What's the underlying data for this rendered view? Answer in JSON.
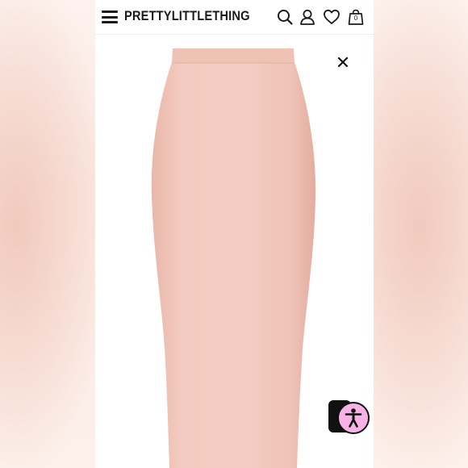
{
  "header": {
    "menu_icon": "hamburger-menu-icon",
    "brand": "PRETTYLITTLETHING",
    "icons": [
      "search-icon",
      "account-icon",
      "wishlist-heart-icon",
      "shopping-bag-icon"
    ],
    "bag_count": "0"
  },
  "product": {
    "image": "nude-midi-bodycon-skirt",
    "skirt_color": "#f2c7bc"
  },
  "overlay": {
    "close_icon": "close-icon",
    "close_glyph": "✕",
    "accessibility_icon": "accessibility-icon",
    "accessibility_color": "#f7b3e6"
  }
}
